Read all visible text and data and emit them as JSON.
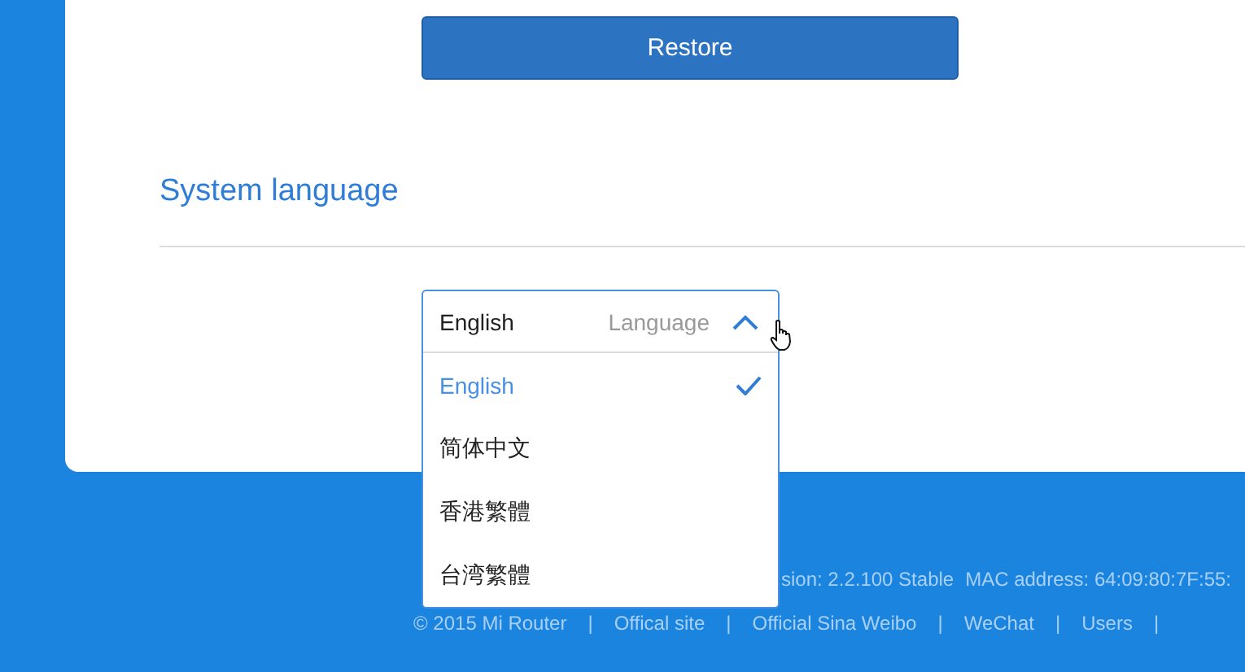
{
  "restore_button": {
    "label": "Restore"
  },
  "section": {
    "title": "System language"
  },
  "language_select": {
    "value": "English",
    "label": "Language",
    "expanded": true,
    "options": [
      {
        "label": "English",
        "selected": true
      },
      {
        "label": "简体中文",
        "selected": false
      },
      {
        "label": "香港繁體",
        "selected": false
      },
      {
        "label": "台湾繁體",
        "selected": false
      }
    ]
  },
  "footer": {
    "info": [
      "sion: 2.2.100 Stable",
      "MAC address: 64:09:80:7F:55:"
    ],
    "links": [
      "© 2015 Mi Router",
      "Offical site",
      "Official Sina Weibo",
      "WeChat",
      "Users"
    ],
    "separator": "|"
  }
}
